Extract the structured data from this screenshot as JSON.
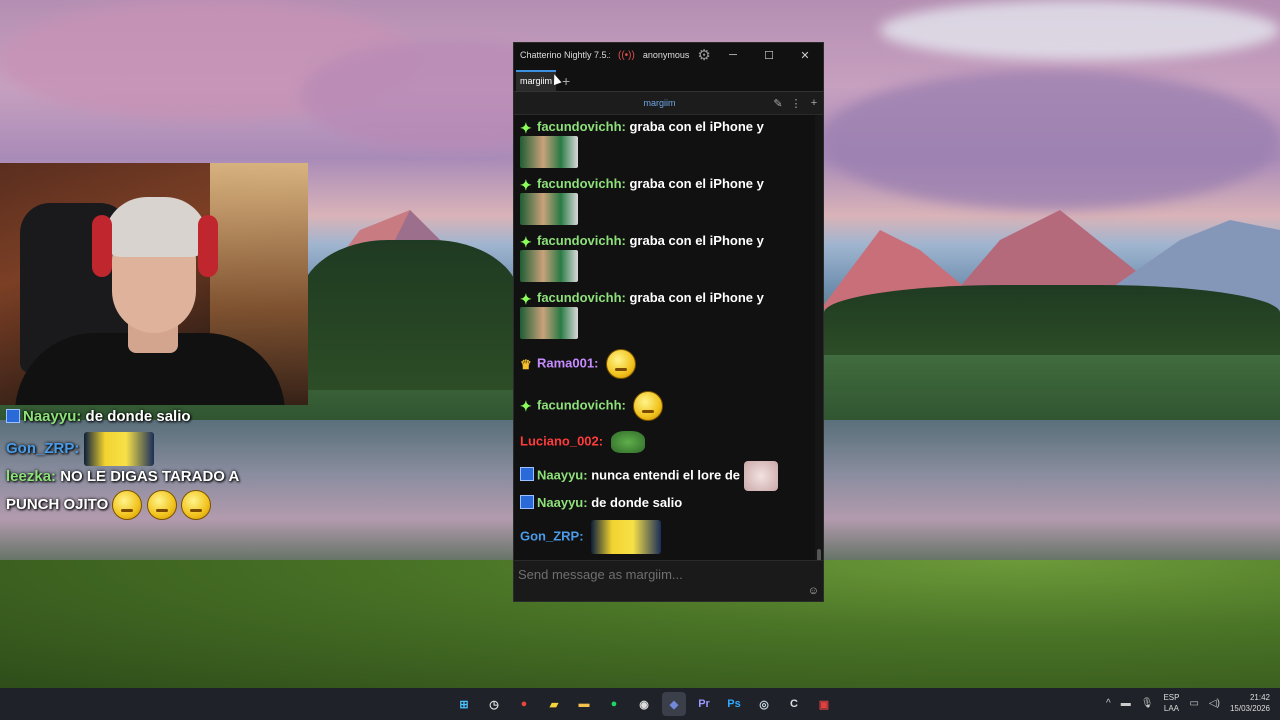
{
  "window": {
    "title": "Chatterino Nightly 7.5.x",
    "status_icon": "live-broadcast-icon",
    "account": "anonymous",
    "tab_label": "margiim",
    "channel": "margiim",
    "input_placeholder": "Send message as margiim..."
  },
  "messages": [
    {
      "badge": "green",
      "user": "facundovichh:",
      "color": "#8ee07a",
      "text": "graba con el iPhone y",
      "emote": "soccer"
    },
    {
      "badge": "green",
      "user": "facundovichh:",
      "color": "#8ee07a",
      "text": "graba con el iPhone y",
      "emote": "soccer"
    },
    {
      "badge": "green",
      "user": "facundovichh:",
      "color": "#8ee07a",
      "text": "graba con el iPhone y",
      "emote": "soccer"
    },
    {
      "badge": "green",
      "user": "facundovichh:",
      "color": "#8ee07a",
      "text": "graba con el iPhone y",
      "emote": "soccer"
    },
    {
      "badge": "crown",
      "user": "Rama001:",
      "color": "#c78cff",
      "text": "",
      "emote": "face"
    },
    {
      "badge": "green",
      "user": "facundovichh:",
      "color": "#8ee07a",
      "text": "",
      "emote": "face"
    },
    {
      "badge": "none",
      "user": "Luciano_002:",
      "color": "#ff3b3b",
      "text": "",
      "emote": "frog"
    },
    {
      "badge": "blue",
      "user": "Naayyu:",
      "color": "#8ee07a",
      "text": "nunca entendi el lore de",
      "emote": "cat"
    },
    {
      "badge": "blue",
      "user": "Naayyu:",
      "color": "#8ee07a",
      "text": "de donde salio",
      "emote": ""
    },
    {
      "badge": "none",
      "user": "Gon_ZRP:",
      "color": "#4a9be8",
      "text": "",
      "emote": "minion"
    },
    {
      "badge": "none",
      "user": "leezka:",
      "color": "#8ee07a",
      "text": "NO LE DIGAS TARADO A PUNCH OJITO",
      "emote": "faces3"
    }
  ],
  "overlay_chat": [
    {
      "badge": "blue",
      "user": "Naayyu:",
      "color": "#8ee07a",
      "text": "de donde salio"
    },
    {
      "badge": "none",
      "user": "Gon_ZRP:",
      "color": "#4a9be8",
      "text": ""
    },
    {
      "badge": "none",
      "user": "leezka:",
      "color": "#8ee07a",
      "text": "NO LE DIGAS TARADO A"
    },
    {
      "badge": "none",
      "user": "",
      "color": "#ffffff",
      "text": "PUNCH OJITO"
    }
  ],
  "taskbar": {
    "apps": [
      {
        "name": "windows-start-icon",
        "glyph": "⊞",
        "color": "#4cc2ff"
      },
      {
        "name": "clock-app-icon",
        "glyph": "◷",
        "color": "#e0e0e0"
      },
      {
        "name": "chrome-icon",
        "glyph": "●",
        "color": "#e8453c"
      },
      {
        "name": "sticky-notes-icon",
        "glyph": "▰",
        "color": "#f5d33a"
      },
      {
        "name": "file-explorer-icon",
        "glyph": "▬",
        "color": "#f2c14e"
      },
      {
        "name": "spotify-icon",
        "glyph": "●",
        "color": "#1ed760"
      },
      {
        "name": "obs-icon",
        "glyph": "◉",
        "color": "#dddddd"
      },
      {
        "name": "discord-icon",
        "glyph": "◆",
        "color": "#7289da"
      },
      {
        "name": "premiere-icon",
        "glyph": "Pr",
        "color": "#9999ff"
      },
      {
        "name": "photoshop-icon",
        "glyph": "Ps",
        "color": "#31a8ff"
      },
      {
        "name": "steam-icon",
        "glyph": "◎",
        "color": "#c7d5e0"
      },
      {
        "name": "chatterino-icon",
        "glyph": "C",
        "color": "#dddddd"
      },
      {
        "name": "voicemeeter-icon",
        "glyph": "▣",
        "color": "#e04040"
      }
    ],
    "language": "ESP",
    "layout": "LAA",
    "time": "21:42",
    "date": "15/03/2026"
  }
}
